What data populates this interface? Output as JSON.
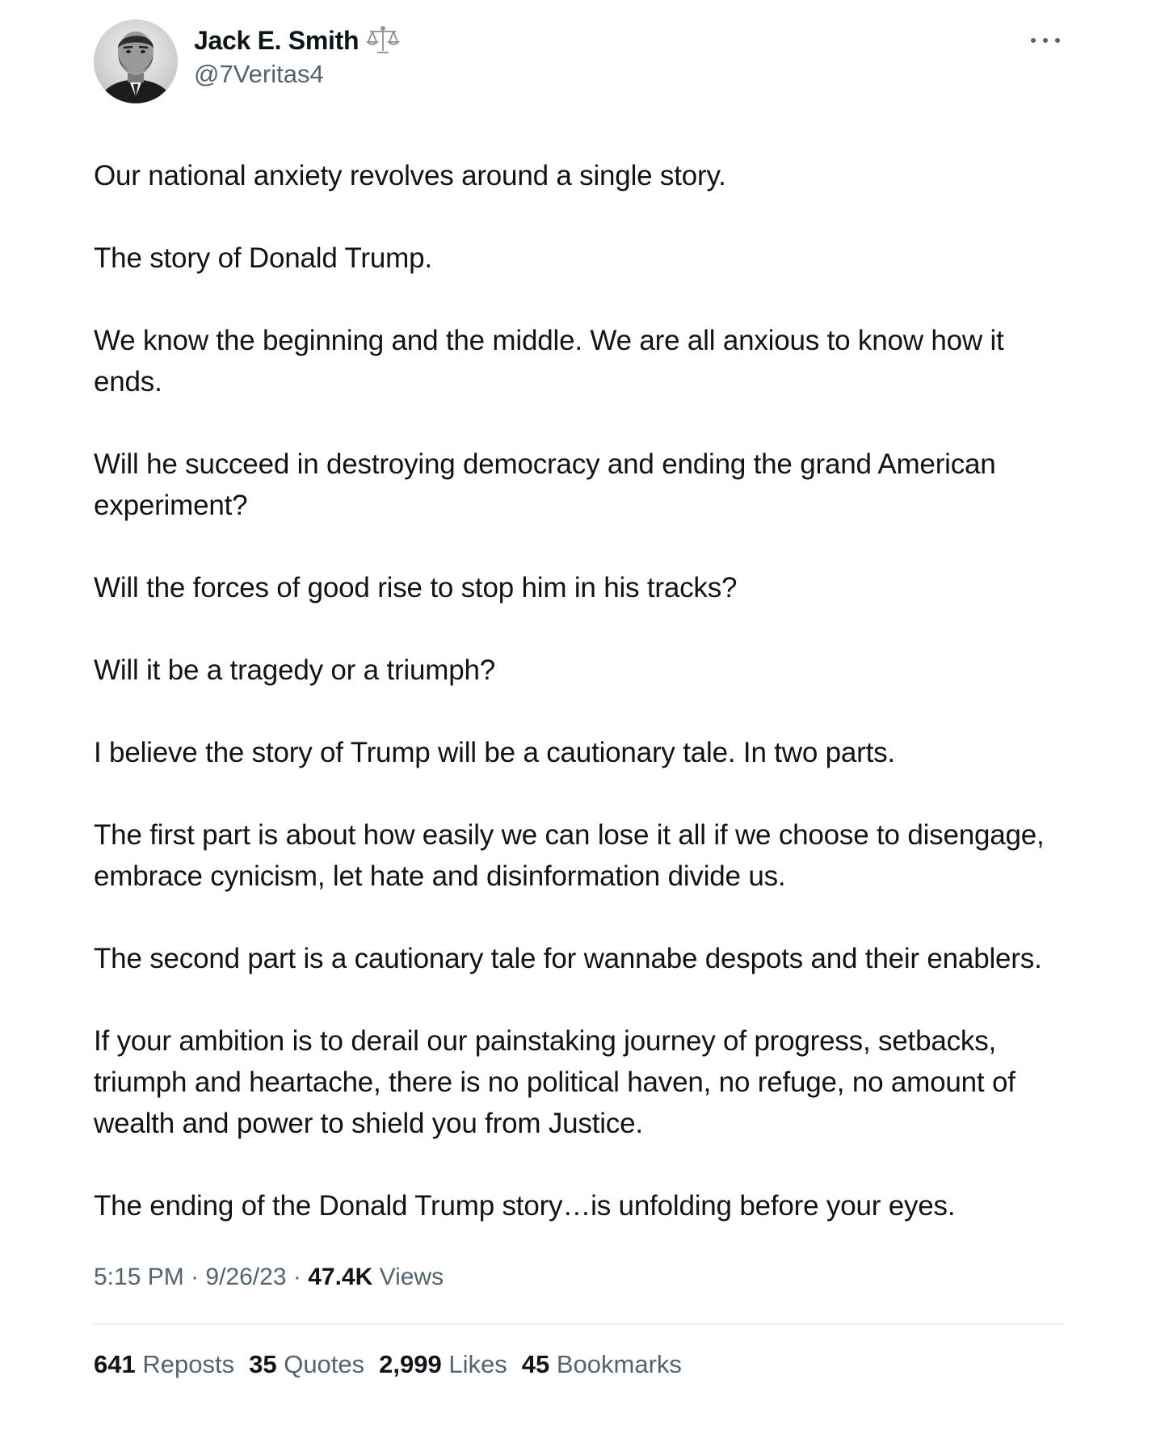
{
  "author": {
    "display_name": "Jack E. Smith",
    "badge_icon": "scales-icon",
    "handle": "@7Veritas4",
    "avatar_icon": "avatar-photo"
  },
  "menu_icon": "more-icon",
  "paragraphs": [
    "Our national anxiety revolves around a single story.",
    "The story of Donald Trump.",
    "We know the beginning and the middle. We are all anxious to know how it ends.",
    "Will he succeed in destroying democracy and ending the grand American experiment?",
    "Will the forces of good rise to stop him in his tracks?",
    "Will it be a tragedy or a triumph?",
    "I believe the story of Trump will be a cautionary tale. In two parts.",
    "The first part is about how easily we can lose it all if we choose to disengage, embrace cynicism, let hate and disinformation divide us.",
    "The second part is a cautionary tale for wannabe despots and their enablers.",
    "If your ambition is to derail our painstaking journey of progress, setbacks, triumph and heartache, there is no political haven, no refuge, no amount of wealth and power to shield you from Justice.",
    "The ending of the Donald Trump story…is unfolding before your eyes."
  ],
  "meta": {
    "time": "5:15 PM",
    "separator": "·",
    "date": "9/26/23",
    "views_count": "47.4K",
    "views_label": "Views"
  },
  "stats": {
    "reposts_count": "641",
    "reposts_label": "Reposts",
    "quotes_count": "35",
    "quotes_label": "Quotes",
    "likes_count": "2,999",
    "likes_label": "Likes",
    "bookmarks_count": "45",
    "bookmarks_label": "Bookmarks"
  },
  "colors": {
    "text_primary": "#0f1419",
    "text_secondary": "#536471",
    "divider": "#eff3f4"
  }
}
